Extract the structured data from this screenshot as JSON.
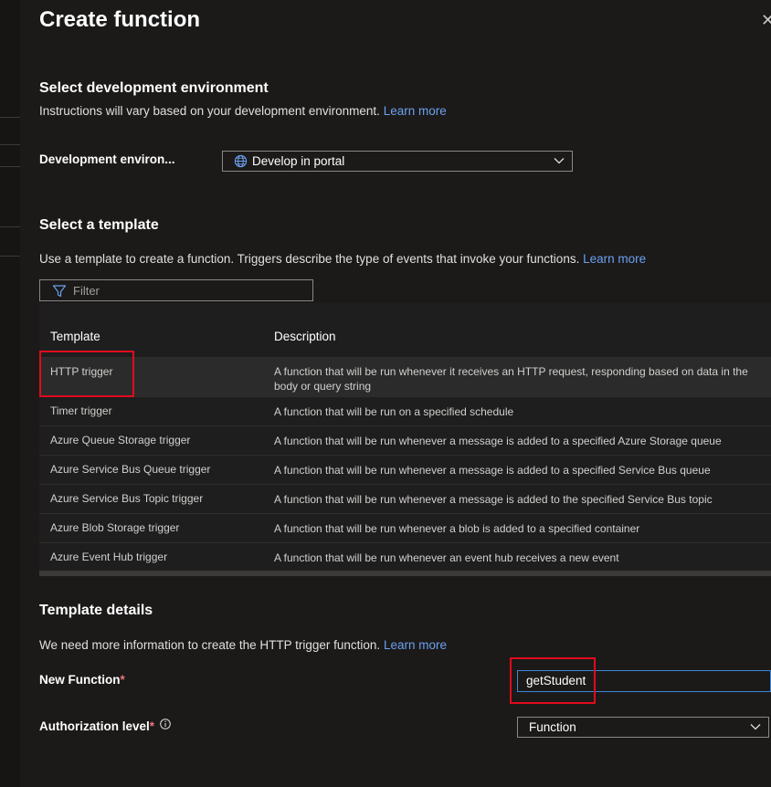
{
  "panel": {
    "title": "Create function",
    "close_glyph": "✕"
  },
  "dev_env": {
    "heading": "Select development environment",
    "description": "Instructions will vary based on your development environment.",
    "learn_more": "Learn more",
    "field_label": "Development environ...",
    "selected_value": "Develop in portal",
    "icon": "globe-icon"
  },
  "template": {
    "heading": "Select a template",
    "description": "Use a template to create a function. Triggers describe the type of events that invoke your functions.",
    "learn_more": "Learn more",
    "filter_placeholder": "Filter",
    "columns": [
      "Template",
      "Description"
    ],
    "rows": [
      {
        "name": "HTTP trigger",
        "description": "A function that will be run whenever it receives an HTTP request, responding based on data in the body or query string"
      },
      {
        "name": "Timer trigger",
        "description": "A function that will be run on a specified schedule"
      },
      {
        "name": "Azure Queue Storage trigger",
        "description": "A function that will be run whenever a message is added to a specified Azure Storage queue"
      },
      {
        "name": "Azure Service Bus Queue trigger",
        "description": "A function that will be run whenever a message is added to a specified Service Bus queue"
      },
      {
        "name": "Azure Service Bus Topic trigger",
        "description": "A function that will be run whenever a message is added to the specified Service Bus topic"
      },
      {
        "name": "Azure Blob Storage trigger",
        "description": "A function that will be run whenever a blob is added to a specified container"
      },
      {
        "name": "Azure Event Hub trigger",
        "description": "A function that will be run whenever an event hub receives a new event"
      }
    ],
    "selected_index": 0
  },
  "details": {
    "heading": "Template details",
    "description": "We need more information to create the HTTP trigger function.",
    "learn_more": "Learn more",
    "new_function_label": "New Function",
    "new_function_value": "getStudent",
    "auth_label": "Authorization level",
    "auth_value": "Function",
    "required_mark": "*"
  },
  "colors": {
    "accent_link": "#6ca0f0",
    "highlight_box": "#e00b1c",
    "focus_border": "#3b86d6"
  }
}
